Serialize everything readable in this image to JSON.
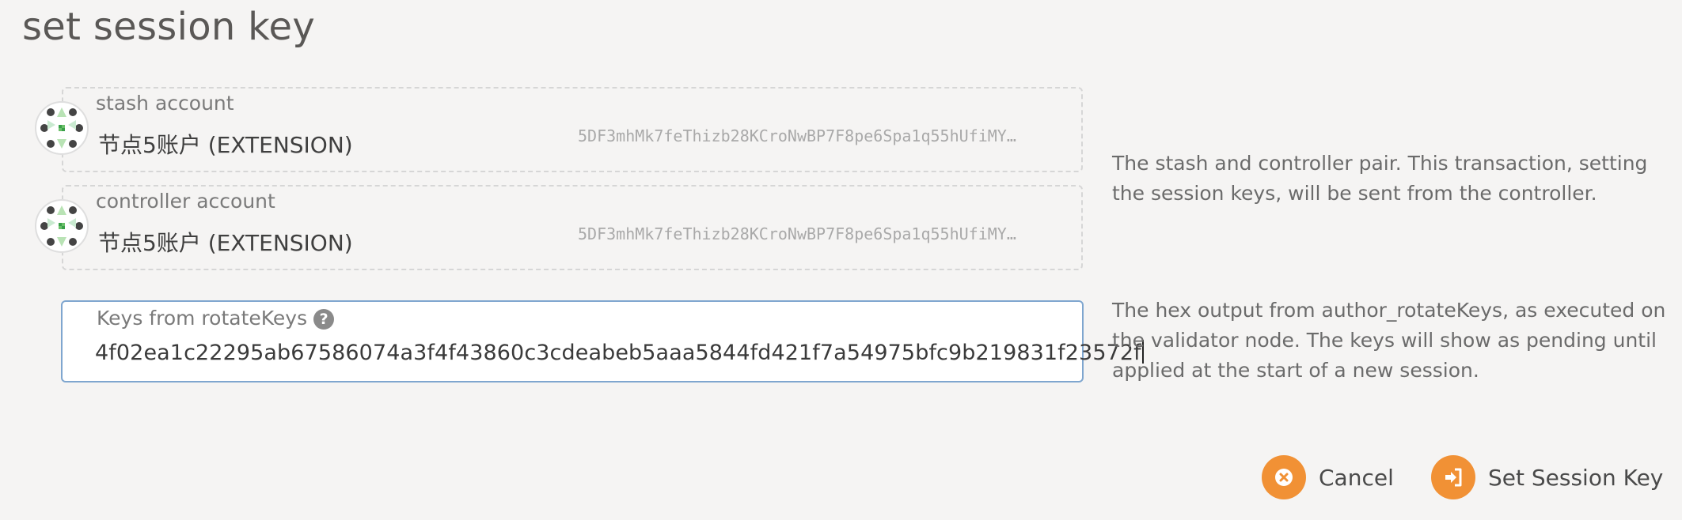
{
  "modal": {
    "title": "set session key"
  },
  "stash": {
    "label": "stash account",
    "name": "节点5账户 (EXTENSION)",
    "address": "5DF3mhMk7feThizb28KCroNwBP7F8pe6Spa1q55hUfiMY…",
    "avatar_icon": "identicon-icon"
  },
  "controller": {
    "label": "controller account",
    "name": "节点5账户 (EXTENSION)",
    "address": "5DF3mhMk7feThizb28KCroNwBP7F8pe6Spa1q55hUfiMY…",
    "avatar_icon": "identicon-icon"
  },
  "help_accounts": "The stash and controller pair. This transaction, setting the session keys, will be sent from the controller.",
  "keys": {
    "label": "Keys from rotateKeys",
    "help_icon": "question-circle-icon",
    "value": "4f02ea1c22295ab67586074a3f4f43860c3cdeabeb5aaa5844fd421f7a54975bfc9b219831f23572f"
  },
  "help_keys": "The hex output from author_rotateKeys, as executed on the validator node. The keys will show as pending until applied at the start of a new session.",
  "actions": {
    "cancel_label": "Cancel",
    "cancel_icon": "close-icon",
    "submit_label": "Set Session Key",
    "submit_icon": "sign-in-icon"
  },
  "colors": {
    "accent": "#f19135",
    "focus_border": "#7fa6cf",
    "background": "#f5f4f3"
  }
}
